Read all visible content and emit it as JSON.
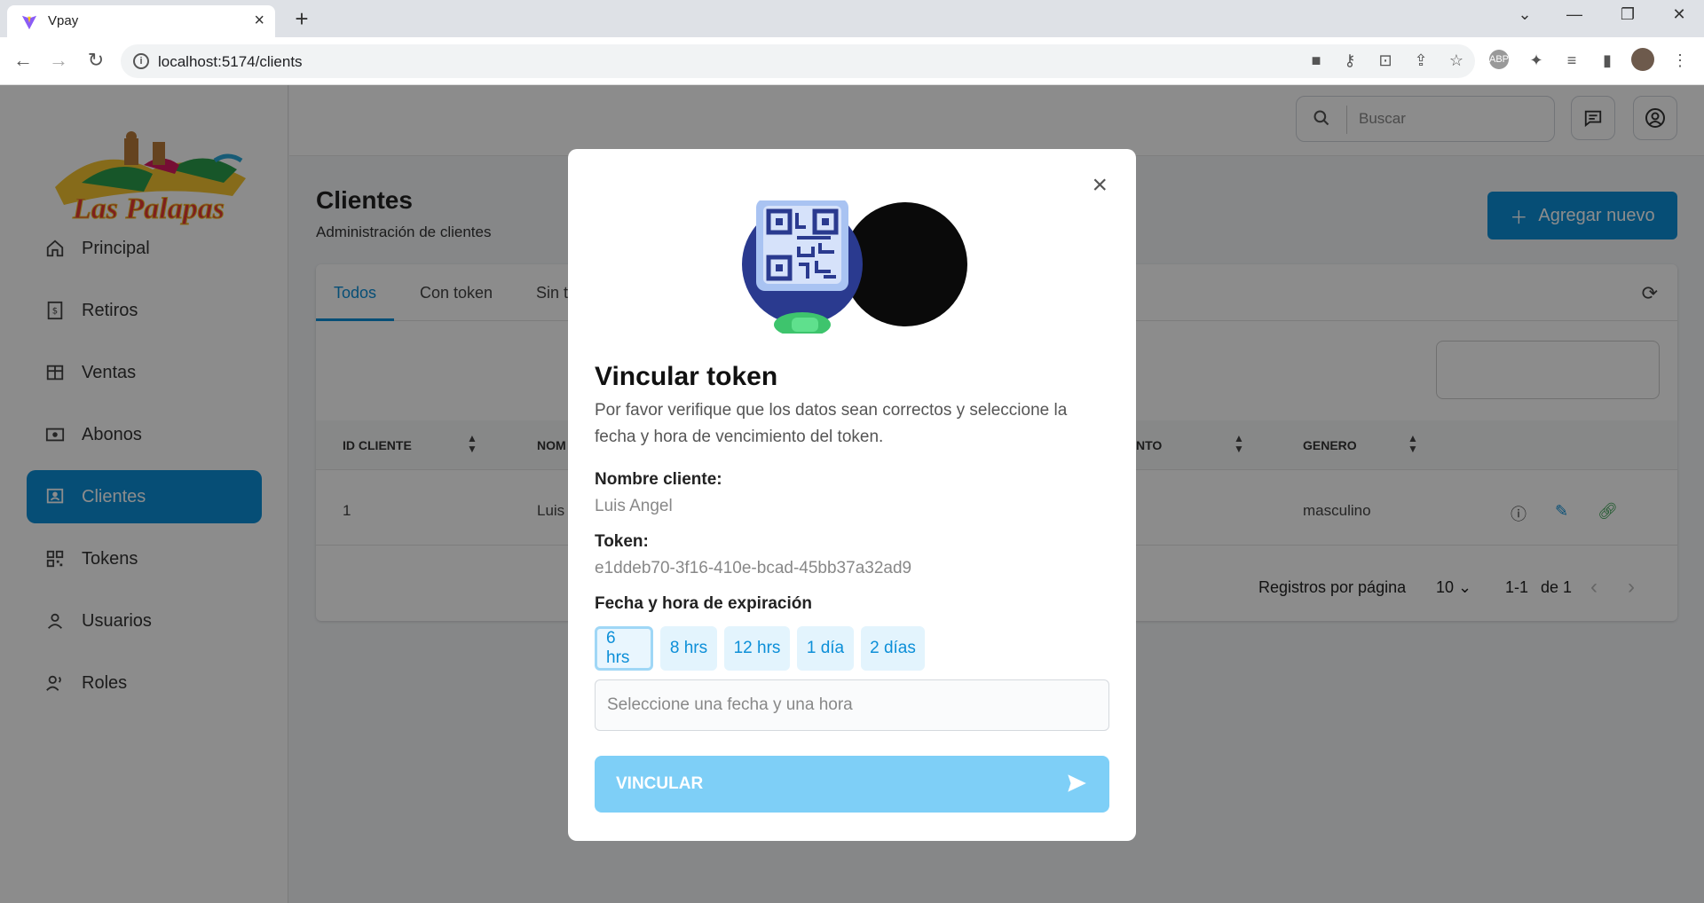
{
  "browser": {
    "tab_title": "Vpay",
    "tab_close": "×",
    "new_tab": "+",
    "url": "localhost:5174/clients",
    "window_controls": [
      "minimize-icon",
      "restore-icon",
      "close-icon"
    ],
    "toolbar_icons": [
      "camera-icon",
      "key-icon",
      "translate-icon",
      "share-icon",
      "bookmark-star-icon",
      "adblock-icon",
      "extensions-icon",
      "media-icon",
      "sidepanel-icon",
      "profile-avatar",
      "menu-icon"
    ]
  },
  "sidebar": {
    "logo_text": "Las Palapas",
    "items": [
      {
        "label": "Principal",
        "icon": "home-icon",
        "active": false
      },
      {
        "label": "Retiros",
        "icon": "receipt-icon",
        "active": false
      },
      {
        "label": "Ventas",
        "icon": "store-icon",
        "active": false
      },
      {
        "label": "Abonos",
        "icon": "cash-icon",
        "active": false
      },
      {
        "label": "Clientes",
        "icon": "client-card-icon",
        "active": true
      },
      {
        "label": "Tokens",
        "icon": "qr-icon",
        "active": false
      },
      {
        "label": "Usuarios",
        "icon": "user-icon",
        "active": false
      },
      {
        "label": "Roles",
        "icon": "roles-icon",
        "active": false
      }
    ]
  },
  "topbar": {
    "search_placeholder": "Buscar"
  },
  "page": {
    "title": "Clientes",
    "subtitle": "Administración de clientes",
    "add_button": "Agregar nuevo",
    "tabs": [
      "Todos",
      "Con token",
      "Sin t"
    ],
    "active_tab": "Todos",
    "columns": [
      "ID CLIENTE",
      "NOM",
      "NTO",
      "GENERO"
    ],
    "rows": [
      {
        "id": "1",
        "name": "Luis",
        "genero": "masculino"
      }
    ],
    "pagination": {
      "rows_per_page_label": "Registros por página",
      "rows_per_page": "10",
      "range": "1-1",
      "of": "de 1"
    }
  },
  "modal": {
    "close": "×",
    "title": "Vincular token",
    "description": "Por favor verifique que los datos sean correctos y seleccione la fecha y hora de vencimiento del token.",
    "client_label": "Nombre cliente:",
    "client_value": "Luis Angel",
    "token_label": "Token:",
    "token_value": "e1ddeb70-3f16-410e-bcad-45bb37a32ad9",
    "expiry_label": "Fecha y hora de expiración",
    "chips": [
      "6 hrs",
      "8 hrs",
      "12 hrs",
      "1 día",
      "2 días"
    ],
    "selected_chip": "6 hrs",
    "datetime_placeholder": "Seleccione una fecha y una hora",
    "submit": "VINCULAR"
  },
  "colors": {
    "accent": "#0c8fd8",
    "accent_light": "#7ecff7",
    "chip_bg": "#e3f4fd"
  }
}
